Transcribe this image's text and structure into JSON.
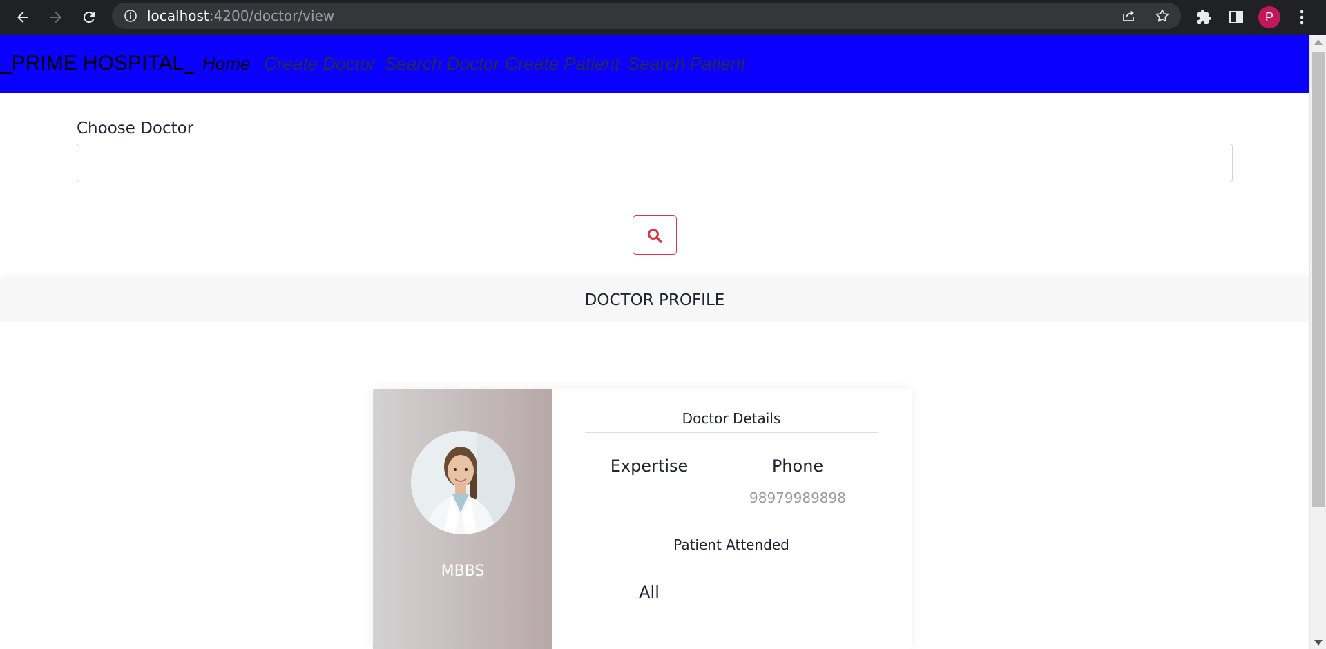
{
  "browser": {
    "url_host": "localhost",
    "url_path": ":4200/doctor/view",
    "avatar_letter": "P"
  },
  "navbar": {
    "brand": "_PRIME HOSPITAL_",
    "links": [
      {
        "label": "Home",
        "active": true
      },
      {
        "label": "Create Doctor",
        "active": false
      },
      {
        "label": "Search Doctor",
        "active": false
      },
      {
        "label": "Create Patient",
        "active": false
      },
      {
        "label": "Search Patient",
        "active": false
      }
    ],
    "background": "#0a00ff"
  },
  "form": {
    "label": "Choose Doctor",
    "selected_value": "",
    "search_icon": "search-icon",
    "accent": "#dc3545"
  },
  "profile": {
    "header": "DOCTOR PROFILE",
    "degree": "MBBS",
    "details_title": "Doctor Details",
    "expertise_label": "Expertise",
    "expertise_value": "",
    "phone_label": "Phone",
    "phone_value": "98979989898",
    "patient_title": "Patient Attended",
    "patient_value": "All"
  }
}
